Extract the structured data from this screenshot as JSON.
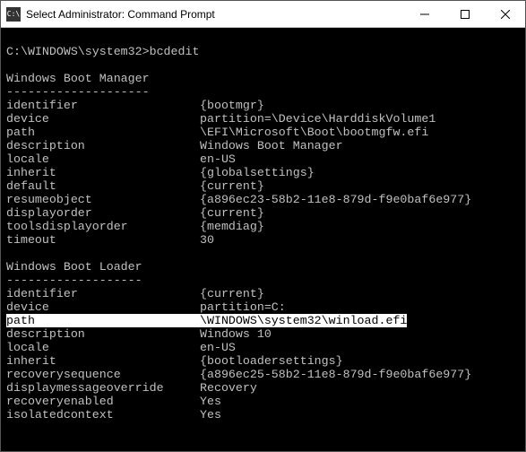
{
  "titlebar": {
    "icon_text": "C:\\",
    "title": "Select Administrator: Command Prompt"
  },
  "prompt": {
    "line": "C:\\WINDOWS\\system32>bcdedit"
  },
  "sections": [
    {
      "heading": "Windows Boot Manager",
      "rule": "--------------------",
      "rows": [
        {
          "k": "identifier",
          "v": "{bootmgr}"
        },
        {
          "k": "device",
          "v": "partition=\\Device\\HarddiskVolume1"
        },
        {
          "k": "path",
          "v": "\\EFI\\Microsoft\\Boot\\bootmgfw.efi"
        },
        {
          "k": "description",
          "v": "Windows Boot Manager"
        },
        {
          "k": "locale",
          "v": "en-US"
        },
        {
          "k": "inherit",
          "v": "{globalsettings}"
        },
        {
          "k": "default",
          "v": "{current}"
        },
        {
          "k": "resumeobject",
          "v": "{a896ec23-58b2-11e8-879d-f9e0baf6e977}"
        },
        {
          "k": "displayorder",
          "v": "{current}"
        },
        {
          "k": "toolsdisplayorder",
          "v": "{memdiag}"
        },
        {
          "k": "timeout",
          "v": "30"
        }
      ]
    },
    {
      "heading": "Windows Boot Loader",
      "rule": "-------------------",
      "rows": [
        {
          "k": "identifier",
          "v": "{current}"
        },
        {
          "k": "device",
          "v": "partition=C:"
        },
        {
          "k": "path",
          "v": "\\WINDOWS\\system32\\winload.efi",
          "highlight": true
        },
        {
          "k": "description",
          "v": "Windows 10"
        },
        {
          "k": "locale",
          "v": "en-US"
        },
        {
          "k": "inherit",
          "v": "{bootloadersettings}"
        },
        {
          "k": "recoverysequence",
          "v": "{a896ec25-58b2-11e8-879d-f9e0baf6e977}"
        },
        {
          "k": "displaymessageoverride",
          "v": "Recovery"
        },
        {
          "k": "recoveryenabled",
          "v": "Yes"
        },
        {
          "k": "isolatedcontext",
          "v": "Yes"
        }
      ]
    }
  ]
}
